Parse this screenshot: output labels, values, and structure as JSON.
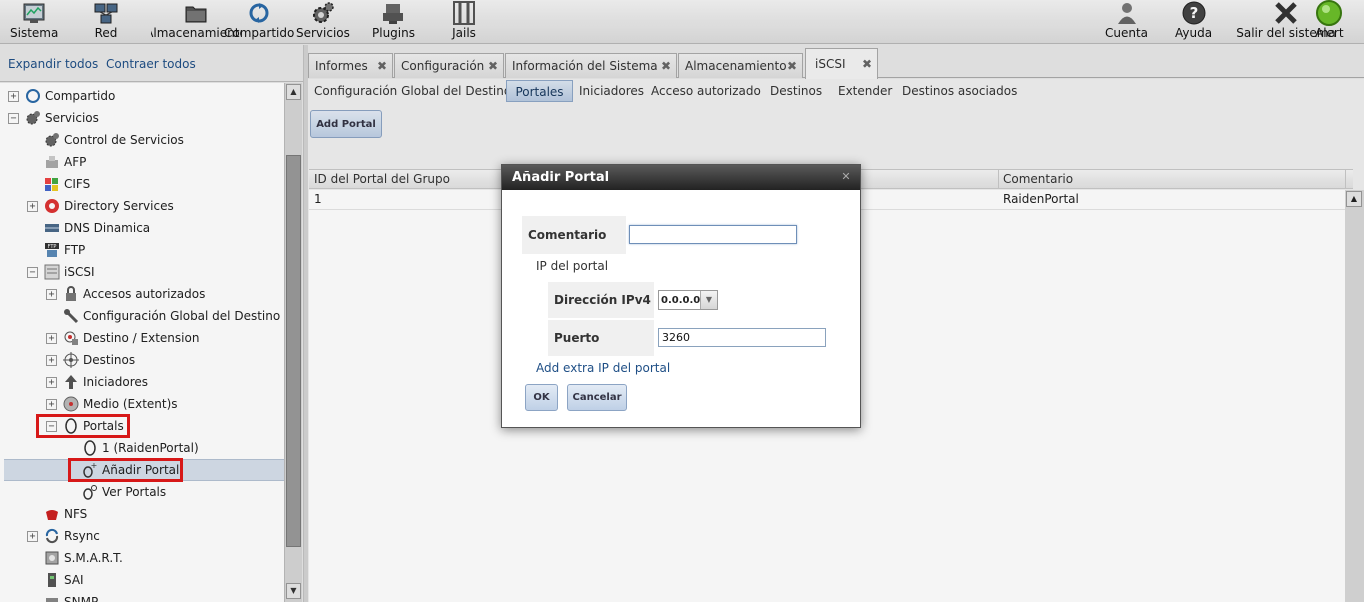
{
  "toolbar": {
    "items": [
      {
        "label": "Sistema",
        "icon": "system-monitor-icon"
      },
      {
        "label": "Red",
        "icon": "network-icon"
      },
      {
        "label": "Almacenamiento",
        "icon": "storage-icon"
      },
      {
        "label": "Compartido",
        "icon": "sharing-icon"
      },
      {
        "label": "Servicios",
        "icon": "services-gear-icon"
      },
      {
        "label": "Plugins",
        "icon": "plugins-icon"
      },
      {
        "label": "Jails",
        "icon": "jails-icon"
      }
    ],
    "right_items": [
      {
        "label": "Cuenta",
        "icon": "users-icon"
      },
      {
        "label": "Ayuda",
        "icon": "help-icon"
      },
      {
        "label": "Salir del sistema",
        "icon": "logout-x-icon"
      },
      {
        "label": "Alert",
        "icon": "alert-light-icon"
      }
    ]
  },
  "left": {
    "expand_all": "Expandir todos",
    "collapse_all": "Contraer todos"
  },
  "tree": [
    {
      "label": "Compartido",
      "expander": "+",
      "icon": "sharing-icon"
    },
    {
      "label": "Servicios",
      "expander": "−",
      "icon": "services-gear-icon"
    },
    {
      "label": "Control de Servicios",
      "expander": "",
      "icon": "services-gear-icon"
    },
    {
      "label": "AFP",
      "expander": "",
      "icon": "afp-icon"
    },
    {
      "label": "CIFS",
      "expander": "",
      "icon": "windows-icon"
    },
    {
      "label": "Directory Services",
      "expander": "+",
      "icon": "directory-icon"
    },
    {
      "label": "DNS Dinamica",
      "expander": "",
      "icon": "dns-icon"
    },
    {
      "label": "FTP",
      "expander": "",
      "icon": "ftp-icon"
    },
    {
      "label": "iSCSI",
      "expander": "−",
      "icon": "iscsi-icon"
    },
    {
      "label": "Accesos autorizados",
      "expander": "+",
      "icon": "lock-icon"
    },
    {
      "label": "Configuración Global del Destino",
      "expander": "",
      "icon": "wrench-icon"
    },
    {
      "label": "Destino / Extension",
      "expander": "+",
      "icon": "target-extent-icon"
    },
    {
      "label": "Destinos",
      "expander": "+",
      "icon": "target-icon"
    },
    {
      "label": "Iniciadores",
      "expander": "+",
      "icon": "initiator-icon"
    },
    {
      "label": "Medio (Extent)s",
      "expander": "+",
      "icon": "extent-icon"
    },
    {
      "label": "Portals",
      "expander": "−",
      "icon": "portal-ring-icon"
    },
    {
      "label": "1 (RaidenPortal)",
      "expander": "",
      "icon": "portal-ring-icon"
    },
    {
      "label": "Añadir Portal",
      "expander": "",
      "icon": "portal-add-icon"
    },
    {
      "label": "Ver Portals",
      "expander": "",
      "icon": "portal-view-icon"
    },
    {
      "label": "NFS",
      "expander": "",
      "icon": "nfs-icon"
    },
    {
      "label": "Rsync",
      "expander": "+",
      "icon": "rsync-icon"
    },
    {
      "label": "S.M.A.R.T.",
      "expander": "",
      "icon": "smart-icon"
    },
    {
      "label": "SAI",
      "expander": "",
      "icon": "ups-icon"
    },
    {
      "label": "SNMP",
      "expander": "",
      "icon": "snmp-icon"
    }
  ],
  "tabs": [
    {
      "label": "Informes"
    },
    {
      "label": "Configuración"
    },
    {
      "label": "Información del Sistema"
    },
    {
      "label": "Almacenamiento"
    },
    {
      "label": "iSCSI"
    }
  ],
  "subtabs": [
    "Configuración Global del Destino",
    "Portales",
    "Iniciadores",
    "Acceso autorizado",
    "Destinos",
    "Extender",
    "Destinos asociados"
  ],
  "content": {
    "add_portal": "Add Portal",
    "columns": [
      "ID del Portal del Grupo",
      "Comentario"
    ],
    "rows": [
      {
        "id": "1",
        "comment": "RaidenPortal"
      }
    ]
  },
  "dialog": {
    "title": "Añadir Portal",
    "comment_label": "Comentario",
    "comment_value": "",
    "ip_section": "IP del portal",
    "ipv4_label": "Dirección IPv4",
    "ipv4_value": "0.0.0.0",
    "port_label": "Puerto",
    "port_value": "3260",
    "add_extra": "Add extra IP del portal",
    "ok": "OK",
    "cancel": "Cancelar"
  },
  "colors": {
    "highlight_box": "#e01a1a",
    "link": "#1f4f86",
    "selected_row": "#d6dfeb"
  }
}
